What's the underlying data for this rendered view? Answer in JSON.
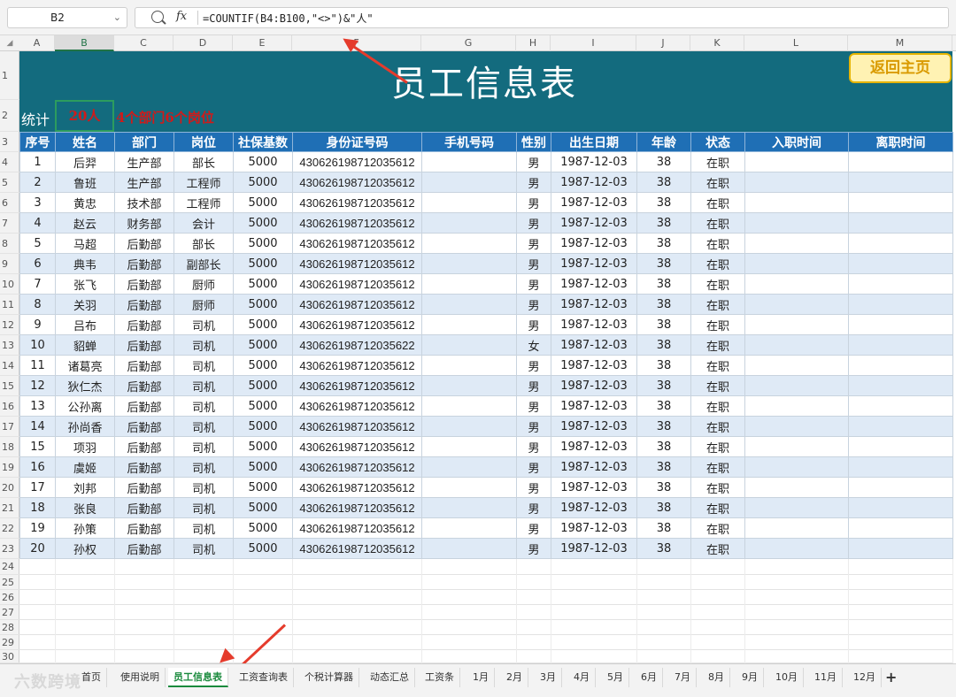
{
  "formula_bar": {
    "cell_ref": "B2",
    "formula": "=COUNTIF(B4:B100,\"<>\")&\"人\""
  },
  "columns": [
    "A",
    "B",
    "C",
    "D",
    "E",
    "F",
    "G",
    "H",
    "I",
    "J",
    "K",
    "L",
    "M"
  ],
  "rows_visible": [
    "1",
    "2",
    "3",
    "4",
    "5",
    "6",
    "7",
    "8",
    "9",
    "10",
    "11",
    "12",
    "13",
    "14",
    "15",
    "16",
    "17",
    "18",
    "19",
    "20",
    "21",
    "22",
    "23",
    "24",
    "25",
    "26",
    "27",
    "28",
    "29",
    "30"
  ],
  "sheet": {
    "title": "员工信息表",
    "back_button": "返回主页",
    "stat_label": "统计",
    "stat_count": "20人",
    "stat_extra": "4个部门6个岗位"
  },
  "table": {
    "headers": [
      "序号",
      "姓名",
      "部门",
      "岗位",
      "社保基数",
      "身份证号码",
      "手机号码",
      "性别",
      "出生日期",
      "年龄",
      "状态",
      "入职时间",
      "离职时间"
    ],
    "rows": [
      [
        "1",
        "后羿",
        "生产部",
        "部长",
        "5000",
        "430626198712035612",
        "",
        "男",
        "1987-12-03",
        "38",
        "在职",
        "",
        ""
      ],
      [
        "2",
        "鲁班",
        "生产部",
        "工程师",
        "5000",
        "430626198712035612",
        "",
        "男",
        "1987-12-03",
        "38",
        "在职",
        "",
        ""
      ],
      [
        "3",
        "黄忠",
        "技术部",
        "工程师",
        "5000",
        "430626198712035612",
        "",
        "男",
        "1987-12-03",
        "38",
        "在职",
        "",
        ""
      ],
      [
        "4",
        "赵云",
        "财务部",
        "会计",
        "5000",
        "430626198712035612",
        "",
        "男",
        "1987-12-03",
        "38",
        "在职",
        "",
        ""
      ],
      [
        "5",
        "马超",
        "后勤部",
        "部长",
        "5000",
        "430626198712035612",
        "",
        "男",
        "1987-12-03",
        "38",
        "在职",
        "",
        ""
      ],
      [
        "6",
        "典韦",
        "后勤部",
        "副部长",
        "5000",
        "430626198712035612",
        "",
        "男",
        "1987-12-03",
        "38",
        "在职",
        "",
        ""
      ],
      [
        "7",
        "张飞",
        "后勤部",
        "厨师",
        "5000",
        "430626198712035612",
        "",
        "男",
        "1987-12-03",
        "38",
        "在职",
        "",
        ""
      ],
      [
        "8",
        "关羽",
        "后勤部",
        "厨师",
        "5000",
        "430626198712035612",
        "",
        "男",
        "1987-12-03",
        "38",
        "在职",
        "",
        ""
      ],
      [
        "9",
        "吕布",
        "后勤部",
        "司机",
        "5000",
        "430626198712035612",
        "",
        "男",
        "1987-12-03",
        "38",
        "在职",
        "",
        ""
      ],
      [
        "10",
        "貂蝉",
        "后勤部",
        "司机",
        "5000",
        "430626198712035622",
        "",
        "女",
        "1987-12-03",
        "38",
        "在职",
        "",
        ""
      ],
      [
        "11",
        "诸葛亮",
        "后勤部",
        "司机",
        "5000",
        "430626198712035612",
        "",
        "男",
        "1987-12-03",
        "38",
        "在职",
        "",
        ""
      ],
      [
        "12",
        "狄仁杰",
        "后勤部",
        "司机",
        "5000",
        "430626198712035612",
        "",
        "男",
        "1987-12-03",
        "38",
        "在职",
        "",
        ""
      ],
      [
        "13",
        "公孙离",
        "后勤部",
        "司机",
        "5000",
        "430626198712035612",
        "",
        "男",
        "1987-12-03",
        "38",
        "在职",
        "",
        ""
      ],
      [
        "14",
        "孙尚香",
        "后勤部",
        "司机",
        "5000",
        "430626198712035612",
        "",
        "男",
        "1987-12-03",
        "38",
        "在职",
        "",
        ""
      ],
      [
        "15",
        "项羽",
        "后勤部",
        "司机",
        "5000",
        "430626198712035612",
        "",
        "男",
        "1987-12-03",
        "38",
        "在职",
        "",
        ""
      ],
      [
        "16",
        "虞姬",
        "后勤部",
        "司机",
        "5000",
        "430626198712035612",
        "",
        "男",
        "1987-12-03",
        "38",
        "在职",
        "",
        ""
      ],
      [
        "17",
        "刘邦",
        "后勤部",
        "司机",
        "5000",
        "430626198712035612",
        "",
        "男",
        "1987-12-03",
        "38",
        "在职",
        "",
        ""
      ],
      [
        "18",
        "张良",
        "后勤部",
        "司机",
        "5000",
        "430626198712035612",
        "",
        "男",
        "1987-12-03",
        "38",
        "在职",
        "",
        ""
      ],
      [
        "19",
        "孙策",
        "后勤部",
        "司机",
        "5000",
        "430626198712035612",
        "",
        "男",
        "1987-12-03",
        "38",
        "在职",
        "",
        ""
      ],
      [
        "20",
        "孙权",
        "后勤部",
        "司机",
        "5000",
        "430626198712035612",
        "",
        "男",
        "1987-12-03",
        "38",
        "在职",
        "",
        ""
      ]
    ]
  },
  "tabs": [
    "首页",
    "使用说明",
    "员工信息表",
    "工资查询表",
    "个税计算器",
    "动态汇总",
    "工资条",
    "1月",
    "2月",
    "3月",
    "4月",
    "5月",
    "6月",
    "7月",
    "8月",
    "9月",
    "10月",
    "11月",
    "12月"
  ],
  "active_tab": "员工信息表",
  "add_tab_label": "+",
  "watermark": "六数跨境",
  "colors": {
    "banner": "#136b7e",
    "header": "#1f6fb5",
    "stripe": "#dfeaf6",
    "accent_red": "#d11a1a",
    "arrow": "#e53b2c"
  }
}
